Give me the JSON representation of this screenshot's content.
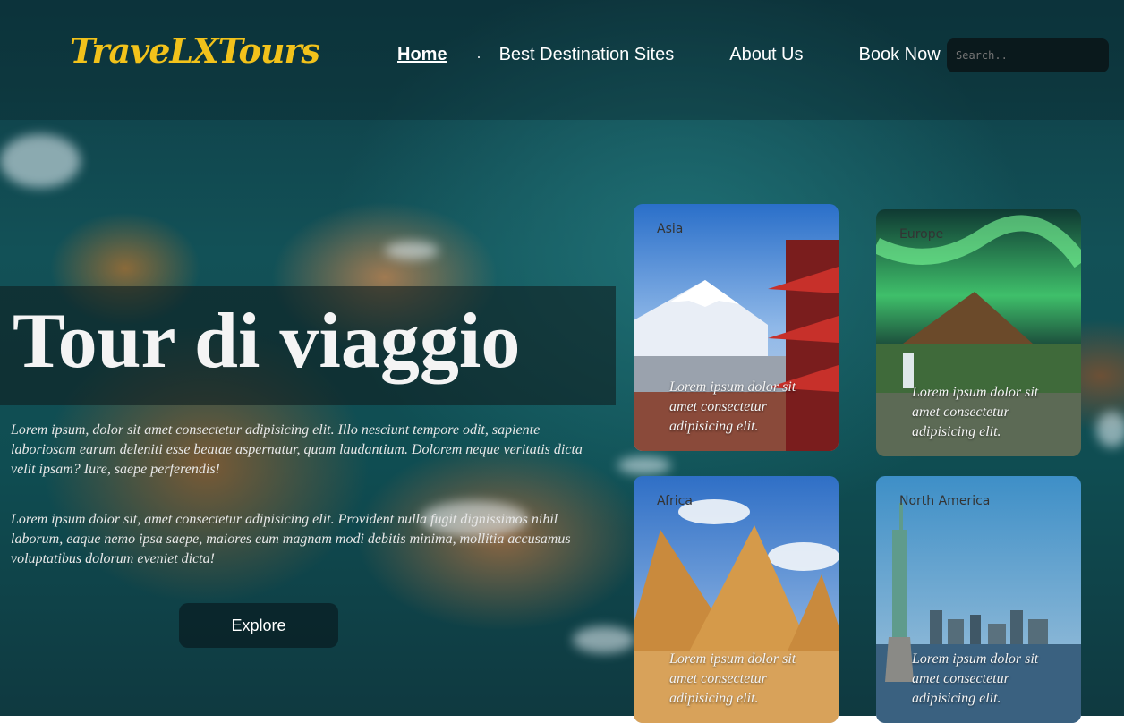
{
  "brand": {
    "logo": "TraveLXTours",
    "accent": "#f2c21b"
  },
  "nav": {
    "home": "Home",
    "destinations": "Best Destination Sites",
    "about": "About Us",
    "book": "Book Now"
  },
  "search": {
    "placeholder": "Search.."
  },
  "hero": {
    "title": "Tour di viaggio",
    "paragraph1": "Lorem ipsum, dolor sit amet consectetur adipisicing elit. Illo nesciunt tempore odit, sapiente laboriosam earum deleniti esse beatae aspernatur, quam laudantium. Dolorem neque veritatis dicta velit ipsam? Iure, saepe perferendis!",
    "paragraph2": "Lorem ipsum dolor sit, amet consectetur adipisicing elit. Provident nulla fugit dignissimos nihil laborum, eaque nemo ipsa saepe, maiores eum magnam modi debitis minima, mollitia accusamus voluptatibus dolorum eveniet dicta!",
    "explore": "Explore"
  },
  "cards": [
    {
      "label": "Asia",
      "text": "Lorem ipsum dolor sit amet consectetur adipisicing elit."
    },
    {
      "label": "Europe",
      "text": "Lorem ipsum dolor sit amet consectetur adipisicing elit."
    },
    {
      "label": "Africa",
      "text": "Lorem ipsum dolor sit amet consectetur adipisicing elit."
    },
    {
      "label": "North America",
      "text": "Lorem ipsum dolor sit amet consectetur adipisicing elit."
    }
  ]
}
